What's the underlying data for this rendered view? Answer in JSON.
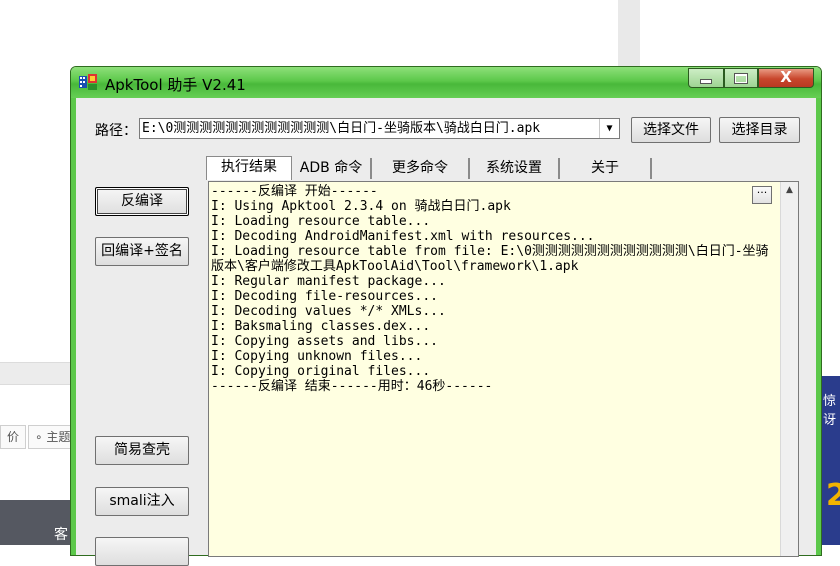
{
  "window": {
    "title": "ApkTool 助手 V2.41",
    "close_glyph": "X"
  },
  "path": {
    "label": "路径：",
    "value": "E:\\0测测测测测测测测测测测测\\白日门-坐骑版本\\骑战白日门.apk"
  },
  "buttons": {
    "select_file": "选择文件",
    "select_dir": "选择目录",
    "decompile": "反编译",
    "recompile_sign": "回编译+签名",
    "simple_shell": "简易查壳",
    "smali_inject": "smali注入",
    "more_dots": "···"
  },
  "tabs": [
    {
      "label": "执行结果",
      "active": true
    },
    {
      "label": "ADB 命令",
      "active": false
    },
    {
      "label": "更多命令",
      "active": false
    },
    {
      "label": "系统设置",
      "active": false
    },
    {
      "label": "关于",
      "active": false
    }
  ],
  "log_lines": [
    "------反编译 开始------",
    "I: Using Apktool 2.3.4 on 骑战白日门.apk",
    "I: Loading resource table...",
    "I: Decoding AndroidManifest.xml with resources...",
    "I: Loading resource table from file: E:\\0测测测测测测测测测测测测\\白日门-坐骑版本\\客户端修改工具ApkToolAid\\Tool\\framework\\1.apk",
    "I: Regular manifest package...",
    "I: Decoding file-resources...",
    "I: Decoding values */* XMLs...",
    "I: Baksmaling classes.dex...",
    "I: Copying assets and libs...",
    "I: Copying unknown files...",
    "I: Copying original files...",
    "------反编译 结束------用时：46秒------"
  ],
  "background": {
    "tag_price": "价",
    "tag_topic": "∘ 主题",
    "dark_text": "客",
    "right_text": "惊讶",
    "right_big": "2"
  },
  "colors": {
    "titlebar_green": "#5cc84a",
    "log_background": "#ffffe1",
    "close_red": "#c8462c"
  }
}
